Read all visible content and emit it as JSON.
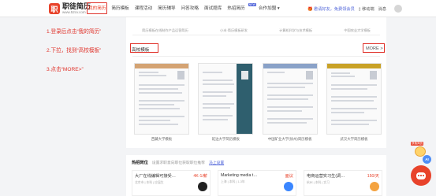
{
  "brand": {
    "name": "职徒简历",
    "url": "www.52cv.com",
    "mark": "职"
  },
  "nav": {
    "items": [
      "我的简历",
      "简历模板",
      "课程活动",
      "简历辅导",
      "问答攻略",
      "面试题库",
      "热招简历",
      "合作加盟 ▾"
    ],
    "hot_badge": "NEW"
  },
  "nav_right": {
    "promo": "🎁 邀请好友，免费领会员",
    "download": "▯ 移动端",
    "message": "消息"
  },
  "steps": [
    "1.登录后点击“我的简历”",
    "2.下拉，找到“高校模板”",
    "3.点击“MORE>”"
  ],
  "prev_captions": [
    "简历模板在线制作产品运营简历",
    "小米·简历模板研发",
    "计算机科学与技术模板",
    "中国农业大学模板"
  ],
  "section": {
    "title": "高校模板",
    "more": "MORE >"
  },
  "templates": [
    {
      "name": "西藏大学模板",
      "color": "#d4a373"
    },
    {
      "name": "延边大学简历模板",
      "color": "#2f5f6e"
    },
    {
      "name": "中国矿业大学(徐州)简历模板",
      "color": "#8aa2c8"
    },
    {
      "name": "武汉大学简历模板",
      "color": "#c9a227"
    }
  ],
  "hot": {
    "title": "热招岗位",
    "desc": "设置求职意向职位获取职位推荐",
    "link": "马上设置"
  },
  "jobs": [
    {
      "title": "大厂在线编辑可接受…",
      "salary": "4K-1/薪",
      "meta": "北京市 | 本科 | 应届生",
      "logo_color": "#222"
    },
    {
      "title": "Marketing media t…",
      "salary": "面议",
      "meta": "上海 | 本科 | 1-3年",
      "logo_color": "#3a86ff"
    },
    {
      "title": "电商运营实习生(调…",
      "salary": "150/天",
      "meta": "杭州 | 本科 | 实习",
      "logo_color": "#f4a340"
    }
  ],
  "widgets": {
    "mascot_badge": "获取简历",
    "ai": "AI"
  }
}
